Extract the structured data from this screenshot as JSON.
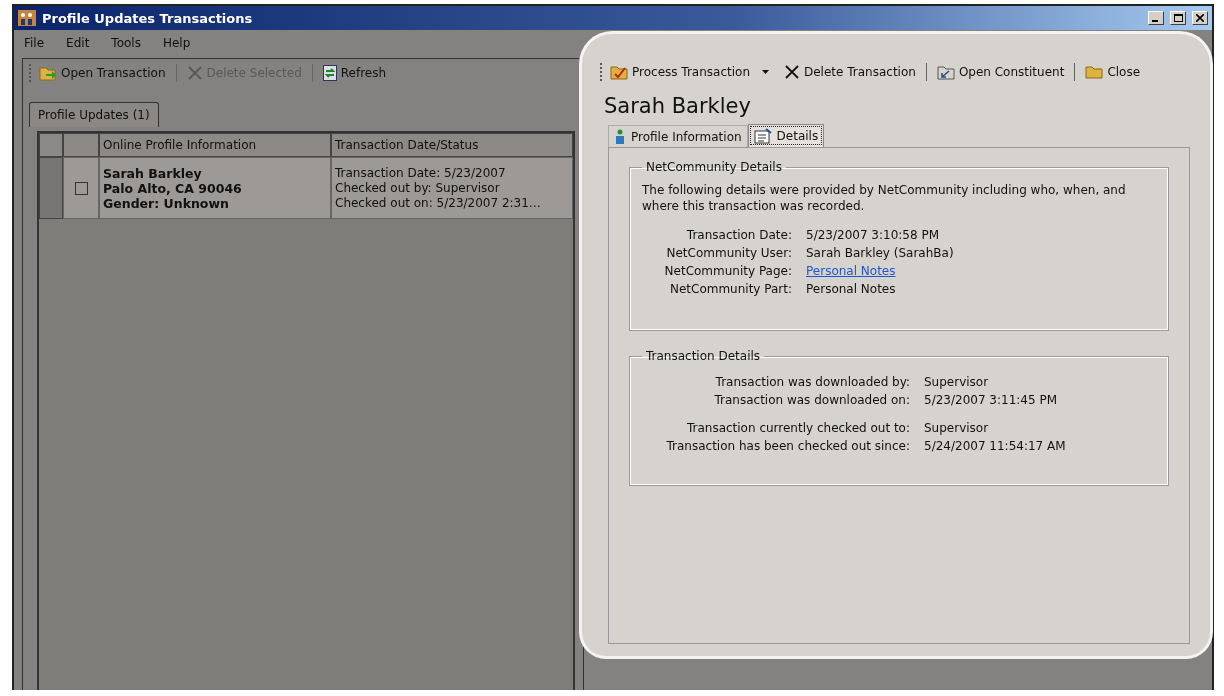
{
  "window": {
    "title": "Profile Updates Transactions"
  },
  "menu": [
    "File",
    "Edit",
    "Tools",
    "Help"
  ],
  "left_toolbar": [
    {
      "label": "Open Transaction",
      "kind": "open",
      "disabled": false
    },
    {
      "label": "Delete Selected",
      "kind": "delete",
      "disabled": true
    },
    {
      "label": "Refresh",
      "kind": "refresh",
      "disabled": false
    }
  ],
  "left_tabs": [
    {
      "label": "Profile Updates (1)",
      "selected": true
    }
  ],
  "grid": {
    "columns": [
      "Online Profile Information",
      "Transaction Date/Status"
    ],
    "rows": [
      {
        "checked": false,
        "profile": [
          "Sarah Barkley",
          "Palo Alto, CA  90046",
          "Gender: Unknown"
        ],
        "status": [
          "Transaction Date: 5/23/2007",
          "Checked out by: Supervisor",
          "Checked out on: 5/23/2007 2:31…"
        ]
      }
    ]
  },
  "right_toolbar": [
    {
      "label": "Process Transaction",
      "kind": "process",
      "dropdown": true
    },
    {
      "label": "Delete Transaction",
      "kind": "delete",
      "dropdown": false
    },
    {
      "label": "Open Constituent",
      "kind": "constituent",
      "dropdown": false
    },
    {
      "label": "Close",
      "kind": "close",
      "dropdown": false
    }
  ],
  "record": {
    "name": "Sarah Barkley"
  },
  "tabs": [
    {
      "label": "Profile Information",
      "kind": "profile",
      "selected": false
    },
    {
      "label": "Details",
      "kind": "details",
      "selected": true
    }
  ],
  "netcommunity": {
    "title": "NetCommunity Details",
    "intro": "The following details were provided by NetCommunity including who, when, and where this transaction was recorded.",
    "fields": [
      {
        "label": "Transaction Date:",
        "value": "5/23/2007 3:10:58 PM",
        "kind": "text"
      },
      {
        "label": "NetCommunity User:",
        "value": "Sarah Barkley (SarahBa)",
        "kind": "text"
      },
      {
        "label": "NetCommunity Page:",
        "value": "Personal Notes",
        "kind": "link"
      },
      {
        "label": "NetCommunity Part:",
        "value": "Personal Notes",
        "kind": "text"
      }
    ]
  },
  "transaction_details": {
    "title": "Transaction Details",
    "groups": [
      [
        {
          "label": "Transaction was downloaded by:",
          "value": "Supervisor"
        },
        {
          "label": "Transaction was downloaded on:",
          "value": "5/23/2007 3:11:45 PM"
        }
      ],
      [
        {
          "label": "Transaction currently checked out to:",
          "value": "Supervisor"
        },
        {
          "label": "Transaction has been checked out since:",
          "value": "5/24/2007 11:54:17 AM"
        }
      ]
    ]
  }
}
